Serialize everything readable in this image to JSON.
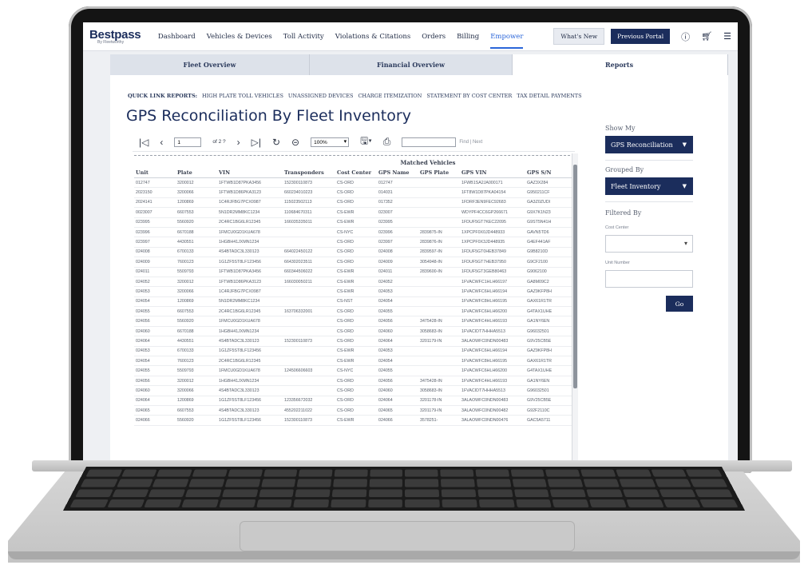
{
  "header": {
    "logo": "Bestpass",
    "logo_sub": "By Fleetworthy",
    "nav": [
      "Dashboard",
      "Vehicles & Devices",
      "Toll Activity",
      "Violations & Citations",
      "Orders",
      "Billing",
      "Empower"
    ],
    "whats_new": "What's New",
    "previous_portal": "Previous Portal"
  },
  "tabs": [
    "Fleet Overview",
    "Financial Overview",
    "Reports"
  ],
  "quick_links": {
    "label": "QUICK LINK REPORTS:",
    "items": [
      "HIGH PLATE TOLL VEHICLES",
      "UNASSIGNED DEVICES",
      "CHARGE ITEMIZATION",
      "STATEMENT BY COST CENTER",
      "TAX DETAIL PAYMENTS"
    ]
  },
  "page_title": "GPS Reconciliation By Fleet Inventory",
  "toolbar": {
    "page": "1",
    "of_pages": "of 2 ?",
    "zoom": "100%",
    "find_label": "Find | Next"
  },
  "report": {
    "group_header": "Matched Vehicles",
    "columns": [
      "Unit",
      "Plate",
      "VIN",
      "Transponders",
      "Cost Center",
      "GPS Name",
      "GPS Plate",
      "GPS VIN",
      "GPS S/N"
    ],
    "rows": [
      [
        "012747",
        "3200012",
        "1FTWB1D87PKA3456",
        "152300110873",
        "CS-ORD",
        "012747",
        "",
        "1FWB1SA2JA000171",
        "GAZ3X284"
      ],
      [
        "2023150",
        "3200066",
        "1FTWB1D86PKA3123",
        "660234010223",
        "CS-ORD",
        "014031",
        "",
        "1FT8W1D87PKA04154",
        "G950211CF"
      ],
      [
        "2024141",
        "1200869",
        "1C4RJFBG7PCX0987",
        "115023502113",
        "CS-ORD",
        "017352",
        "",
        "1FDRF3EN9FEC92683",
        "GA3Z0ZUDI"
      ],
      [
        "0023007",
        "6607553",
        "5N1DR2MM8KC1234",
        "110684670311",
        "CS-EWR",
        "023007",
        "",
        "WDYPF4CC6GP266671",
        "G9X7K1N23"
      ],
      [
        "023995",
        "5560920",
        "2C4RC1BG6LR12345",
        "166035335011",
        "CS-EWR",
        "023995",
        "",
        "1FDUF5GT7KEC22095",
        "G9ST5N41H"
      ],
      [
        "023996",
        "6670188",
        "1FMCU0GD1KUA678",
        "",
        "CS-NYC",
        "023996",
        "2839875-IN",
        "1XPCPF0X0JD448933",
        "GAVN5TD6"
      ],
      [
        "023997",
        "4430551",
        "1HGBH41JXMN1234",
        "",
        "CS-ORD",
        "023997",
        "2839876-IN",
        "1XPCPF0X3JD448935",
        "G4EF441AF"
      ],
      [
        "024008",
        "6700133",
        "4S4BTADC3L330123",
        "664022450122",
        "CS-ORD",
        "024008",
        "2839597-IN",
        "1FDUF5GT0HEB37849",
        "G9B8210D"
      ],
      [
        "024009",
        "7600123",
        "1G1ZF5ST8LF123456",
        "664302023511",
        "CS-ORD",
        "024009",
        "3054948-IN",
        "1FDUF5GT7HEB37950",
        "G9CF2100"
      ],
      [
        "024011",
        "5509793",
        "1FTWB1D87PKA3456",
        "660344506022",
        "CS-EWR",
        "024011",
        "2839600-IN",
        "1FDUF5GT3GEB80463",
        "G9062100"
      ],
      [
        "024052",
        "3200012",
        "1FTWB1D86PKA3123",
        "166030050211",
        "CS-EWR",
        "024052",
        "",
        "1FVACWFC1HLH66197",
        "GA8M09C2"
      ],
      [
        "024053",
        "3200066",
        "1C4RJFBG7PCX0987",
        "",
        "CS-EWR",
        "024053",
        "",
        "1FVACWFC6HLH66194",
        "GAZ9KFP8H"
      ],
      [
        "024054",
        "1200869",
        "5N1DR2MM8KC1234",
        "",
        "CS-NST",
        "024054",
        "",
        "1FVACWFC8HLH66195",
        "GAX61R1TR"
      ],
      [
        "024055",
        "6607553",
        "2C4RC1BG6LR12345",
        "163706332001",
        "CS-ORD",
        "024055",
        "",
        "1FVACWFC6HLH66200",
        "G4TAX1UHE"
      ],
      [
        "024056",
        "5560920",
        "1FMCU0GD1KUA678",
        "",
        "CS-ORD",
        "024056",
        "3475428-IN",
        "1FVACWFC4HLH66193",
        "GA1NY6EN"
      ],
      [
        "024060",
        "6670188",
        "1HGBH41JXMN1234",
        "",
        "CS-ORD",
        "024060",
        "3058683-IN",
        "1FVACIDT7HHHA5513",
        "G96032501"
      ],
      [
        "024064",
        "4430551",
        "4S4BTADC3L330123",
        "152300110873",
        "CS-ORD",
        "024064",
        "3201179-IN",
        "3ALAOWFC0NDN00483",
        "G9V25CB5E"
      ],
      [
        "024053",
        "6700133",
        "1G1ZF5ST8LF123456",
        "",
        "CS-EWR",
        "024053",
        "",
        "1FVACWFC6HLH66194",
        "GAZ9KFP8H"
      ],
      [
        "024054",
        "7600123",
        "2C4RC1BG6LR12345",
        "",
        "CS-EWR",
        "024054",
        "",
        "1FVACWFC8HLH66195",
        "GAX61R1TR"
      ],
      [
        "024055",
        "5509793",
        "1FMCU0GD1KUA678",
        "124506606603",
        "CS-NYC",
        "024055",
        "",
        "1FVACWFC6HLH66200",
        "G4TAX1UHE"
      ],
      [
        "024056",
        "3200012",
        "1HGBH41JXMN1234",
        "",
        "CS-ORD",
        "024056",
        "3475428-IN",
        "1FVACWFC4HLH66193",
        "GA1NY6EN"
      ],
      [
        "024060",
        "3200066",
        "4S4BTADC3L330123",
        "",
        "CS-ORD",
        "024060",
        "3058683-IN",
        "1FVACIDT7HHHA5513",
        "G96032501"
      ],
      [
        "024064",
        "1200869",
        "1G1ZF5ST8LF123456",
        "123356672032",
        "CS-ORD",
        "024064",
        "3201178-IN",
        "3ALAOWFC0NDN00483",
        "G9V25CB5E"
      ],
      [
        "024065",
        "6607553",
        "4S4BTADC3L330123",
        "455202211022",
        "CS-ORD",
        "024065",
        "3201179-IN",
        "3ALAOWFC0NDN00482",
        "G92F2110C"
      ],
      [
        "024066",
        "5560920",
        "1G1ZF5ST8LF123456",
        "152300110873",
        "CS-EWR",
        "024066",
        "3578251-",
        "3ALAOWFC0NDN00476",
        "GAC5A5711"
      ]
    ]
  },
  "side_panel": {
    "show_my_label": "Show My",
    "show_my_value": "GPS Reconciliation",
    "grouped_by_label": "Grouped By",
    "grouped_by_value": "Fleet Inventory",
    "filtered_by_label": "Filtered By",
    "cost_center_label": "Cost Center",
    "unit_number_label": "Unit Number",
    "go_label": "Go"
  }
}
